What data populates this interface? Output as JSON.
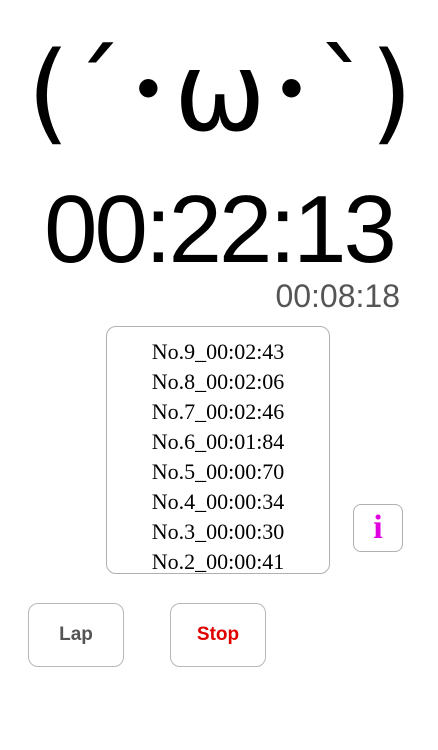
{
  "face": "(´･ω･`)",
  "timer": {
    "main": "00:22:13",
    "lap": "00:08:18"
  },
  "laps": [
    "No.9_00:02:43",
    "No.8_00:02:06",
    "No.7_00:02:46",
    "No.6_00:01:84",
    "No.5_00:00:70",
    "No.4_00:00:34",
    "No.3_00:00:30",
    "No.2_00:00:41"
  ],
  "buttons": {
    "info": "i",
    "lap": "Lap",
    "stop": "Stop"
  },
  "colors": {
    "info": "#e000e0",
    "stop": "#e00000",
    "lap": "#555555"
  }
}
